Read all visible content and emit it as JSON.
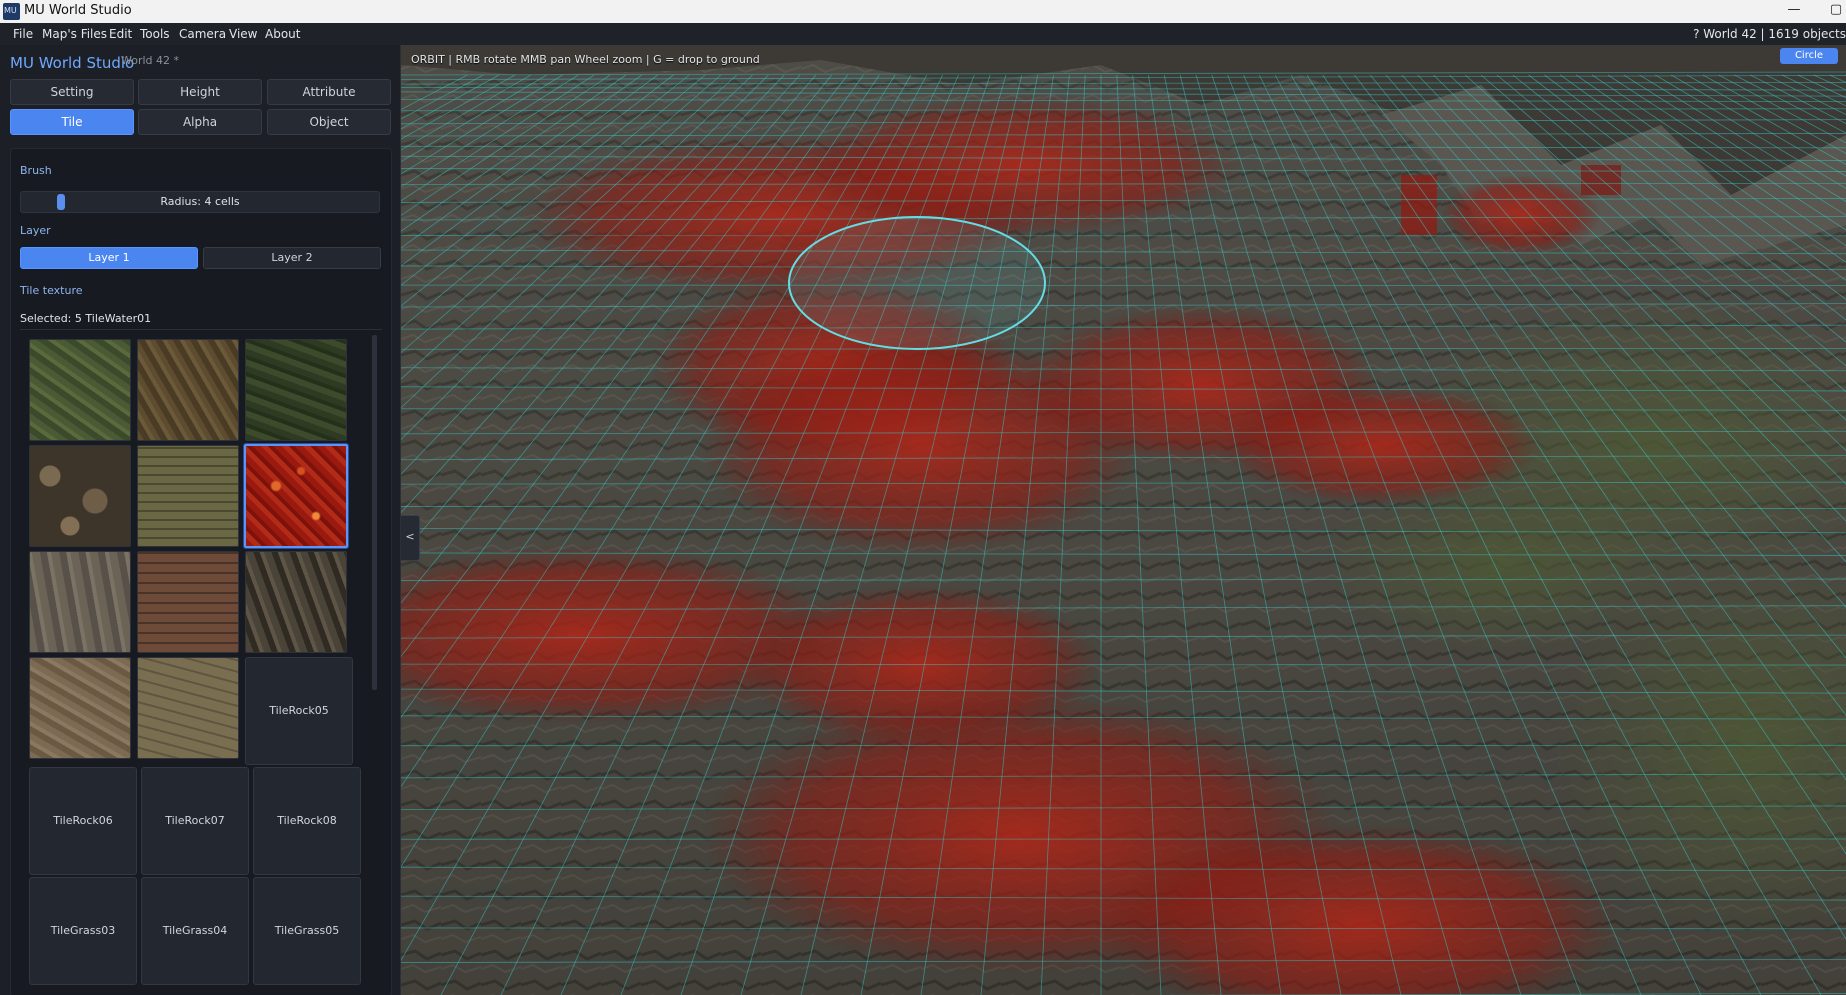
{
  "window": {
    "title": "MU World Studio",
    "minimize_glyph": "—",
    "maximize_glyph": "▢"
  },
  "menu": {
    "items": [
      "File",
      "Map's Files",
      "Edit",
      "Tools",
      "Camera",
      "View",
      "About"
    ],
    "status": "? World 42 | 1619 objects"
  },
  "panel": {
    "title": "MU World Studio",
    "subtitle": "World 42 *",
    "modes": [
      {
        "label": "Setting",
        "active": false
      },
      {
        "label": "Height",
        "active": false
      },
      {
        "label": "Attribute",
        "active": false
      },
      {
        "label": "Tile",
        "active": true
      },
      {
        "label": "Alpha",
        "active": false
      },
      {
        "label": "Object",
        "active": false
      }
    ],
    "brush_label": "Brush",
    "radius_text": "Radius: 4 cells",
    "layer_label": "Layer",
    "layers": [
      {
        "label": "Layer 1",
        "active": true
      },
      {
        "label": "Layer 2",
        "active": false
      }
    ],
    "texture_label": "Tile texture",
    "selected_text": "Selected: 5  TileWater01",
    "tile_cards": [
      "TileRock05",
      "TileRock06",
      "TileRock07",
      "TileRock08",
      "TileGrass03",
      "TileGrass04",
      "TileGrass05"
    ]
  },
  "viewport": {
    "hud": "ORBIT  |  RMB rotate   MMB pan   Wheel zoom   |   G = drop to ground",
    "collapse_glyph": "<",
    "shape_label": "Circle",
    "grid_color": "#37c9c9",
    "lava_color": "#9a1f18"
  }
}
